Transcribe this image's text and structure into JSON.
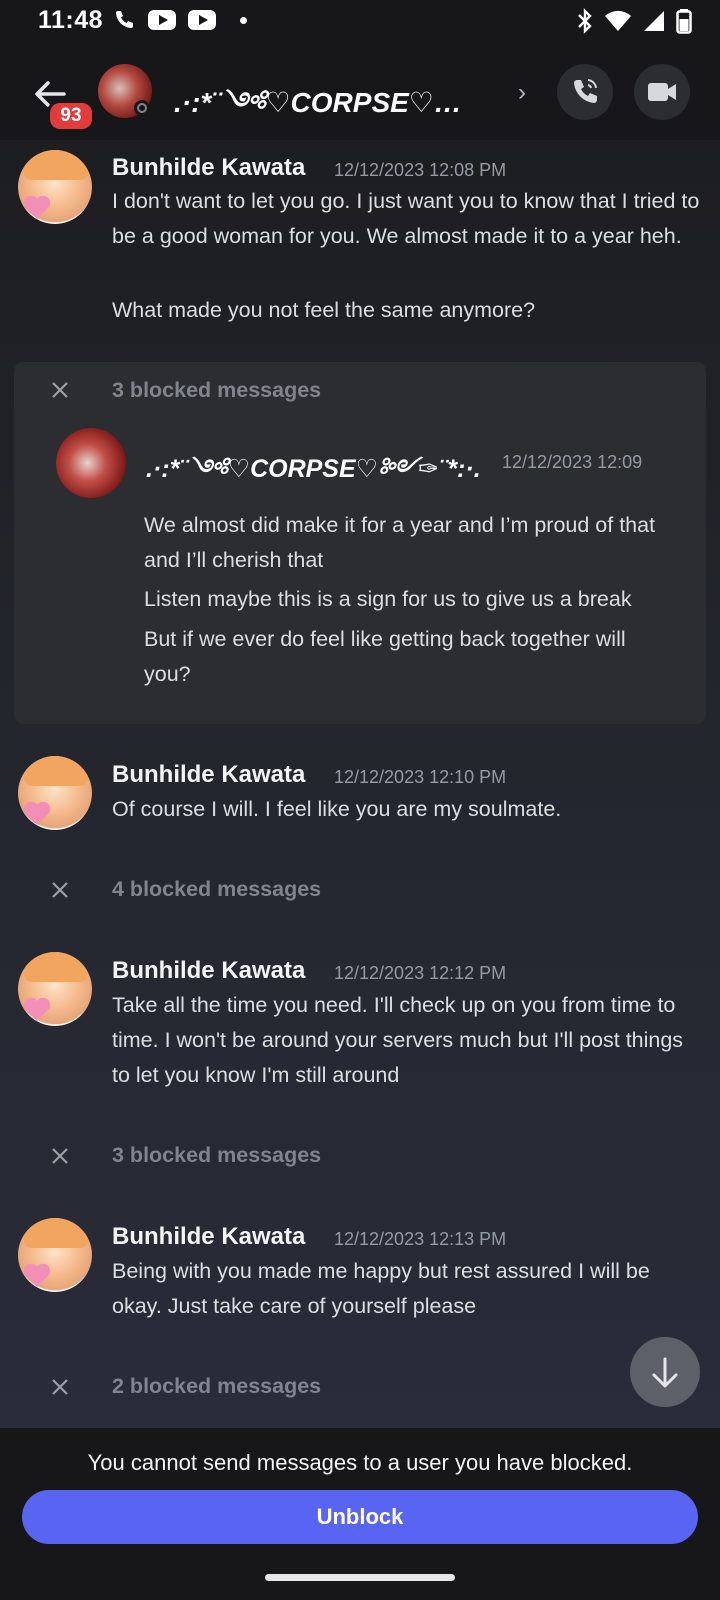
{
  "status_bar": {
    "time": "11:48"
  },
  "header": {
    "unread_badge": "93",
    "title": ".·:*¨༺♡CORPSE♡…"
  },
  "messages": [
    {
      "author": "Bunhilde Kawata",
      "timestamp": "12/12/2023 12:08 PM",
      "lines": [
        "I don't want to let you go. I just want you to know that I tried to be a good woman for you. We almost made it to a year heh.",
        "What made you not feel the same anymore?"
      ]
    },
    {
      "author": "Bunhilde Kawata",
      "timestamp": "12/12/2023 12:10 PM",
      "lines": [
        "Of course I will. I feel like you are my soulmate."
      ]
    },
    {
      "author": "Bunhilde Kawata",
      "timestamp": "12/12/2023 12:12 PM",
      "lines": [
        "Take all the time you need. I'll check up on you from time to time. I won't be around your servers much but I'll post things to let you know I'm still around"
      ]
    },
    {
      "author": "Bunhilde Kawata",
      "timestamp": "12/12/2023 12:13 PM",
      "lines": [
        "Being with you made me happy but rest assured I will be okay. Just take care of yourself please"
      ]
    }
  ],
  "blocked_expanded": {
    "label": "3 blocked messages",
    "author": ".·:*¨༺♡CORPSE♡༻✑¨*:·.",
    "timestamp": "12/12/2023 12:09",
    "lines": [
      "We almost did make it for a year and I’m proud of that and I’ll cherish that",
      "Listen maybe this is a sign for us to give us a break",
      "But if we ever do feel like getting back together will you?"
    ]
  },
  "blocked_collapsed": [
    {
      "label": "4 blocked messages"
    },
    {
      "label": "3 blocked messages"
    },
    {
      "label": "2 blocked messages"
    }
  ],
  "footer": {
    "note": "You cannot send messages to a user you have blocked.",
    "unblock_label": "Unblock"
  },
  "colors": {
    "accent": "#5865f2",
    "badge": "#e23b3b"
  },
  "icons": [
    "phone-icon",
    "youtube-icon",
    "bluetooth-icon",
    "wifi-icon",
    "signal-icon",
    "battery-icon",
    "back-arrow-icon",
    "chevron-right-icon",
    "voice-call-icon",
    "video-call-icon",
    "close-icon",
    "arrow-down-icon"
  ]
}
